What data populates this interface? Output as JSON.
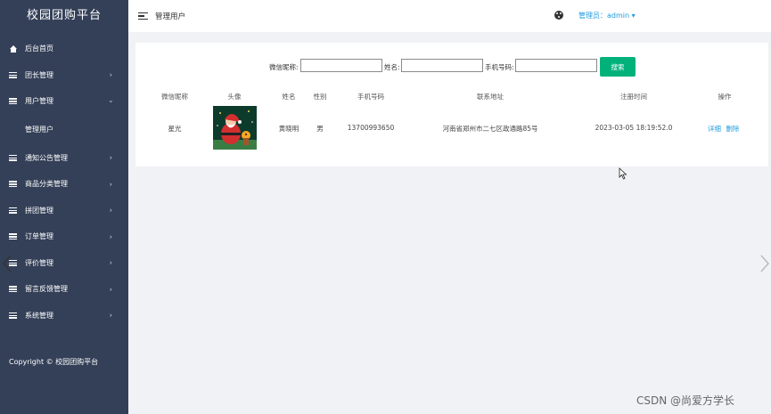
{
  "sidebar": {
    "brand": "校园团购平台",
    "items": [
      {
        "label": "后台首页",
        "icon": "home-icon"
      },
      {
        "label": "团长管理",
        "icon": "bars-icon"
      },
      {
        "label": "用户管理",
        "icon": "bars-icon"
      },
      {
        "label": "通知公告管理",
        "icon": "bars-icon"
      },
      {
        "label": "商品分类管理",
        "icon": "bars-icon"
      },
      {
        "label": "拼团管理",
        "icon": "bars-icon"
      },
      {
        "label": "订单管理",
        "icon": "bars-icon"
      },
      {
        "label": "评价管理",
        "icon": "bars-icon"
      },
      {
        "label": "留言反馈管理",
        "icon": "bars-icon"
      },
      {
        "label": "系统管理",
        "icon": "bars-icon"
      }
    ],
    "sub_item": "管理用户",
    "copyright": "Copyright © 校园团购平台"
  },
  "header": {
    "breadcrumb": "管理用户",
    "admin": "管理员：admin ▾"
  },
  "search": {
    "wechat_label": "微信昵称:",
    "name_label": "姓名:",
    "phone_label": "手机号码:",
    "wechat_value": "",
    "name_value": "",
    "phone_value": "",
    "button": "搜索"
  },
  "table": {
    "headers": [
      "微信昵称",
      "头像",
      "姓名",
      "性别",
      "手机号码",
      "联系地址",
      "注册时间",
      "操作"
    ],
    "rows": [
      {
        "nickname": "星光",
        "name": "黄晓明",
        "gender": "男",
        "phone": "13700993650",
        "address": "河南省郑州市二七区政通路85号",
        "registered": "2023-03-05 18:19:52.0",
        "detail": "详细",
        "delete": "删除"
      }
    ]
  },
  "watermark": "CSDN @尚爱方学长",
  "colors": {
    "sidebar": "#344058",
    "accent_green": "#00b27a",
    "link_blue": "#1f9cde"
  }
}
